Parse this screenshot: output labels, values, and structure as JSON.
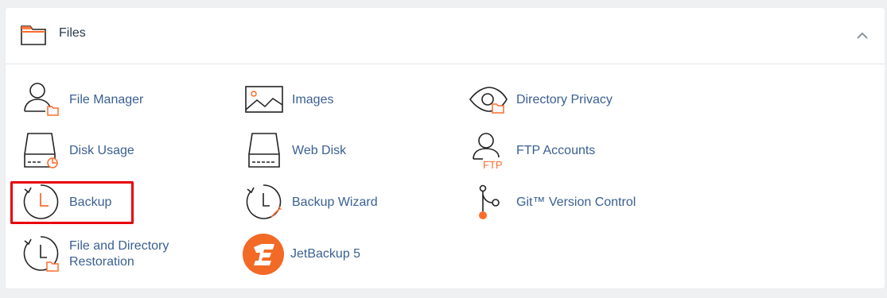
{
  "section": {
    "title": "Files",
    "header_icon": "folder-icon",
    "collapse_icon": "chevron-up-icon"
  },
  "items": [
    {
      "label": "File Manager",
      "icon": "file-manager-icon"
    },
    {
      "label": "Images",
      "icon": "images-icon"
    },
    {
      "label": "Directory Privacy",
      "icon": "directory-privacy-icon"
    },
    {
      "label": "Disk Usage",
      "icon": "disk-usage-icon"
    },
    {
      "label": "Web Disk",
      "icon": "web-disk-icon"
    },
    {
      "label": "FTP Accounts",
      "icon": "ftp-accounts-icon",
      "icon_text": "FTP"
    },
    {
      "label": "Backup",
      "icon": "backup-icon",
      "highlighted": true
    },
    {
      "label": "Backup Wizard",
      "icon": "backup-wizard-icon"
    },
    {
      "label": "Git™ Version Control",
      "icon": "git-icon"
    },
    {
      "label": "File and Directory Restoration",
      "icon": "file-restoration-icon"
    },
    {
      "label": "JetBackup 5",
      "icon": "jetbackup-logo-icon"
    }
  ],
  "colors": {
    "accent": "#ff6c2c",
    "link": "#3a5f91",
    "icon_stroke": "#222222",
    "highlight": "#e8000b"
  }
}
